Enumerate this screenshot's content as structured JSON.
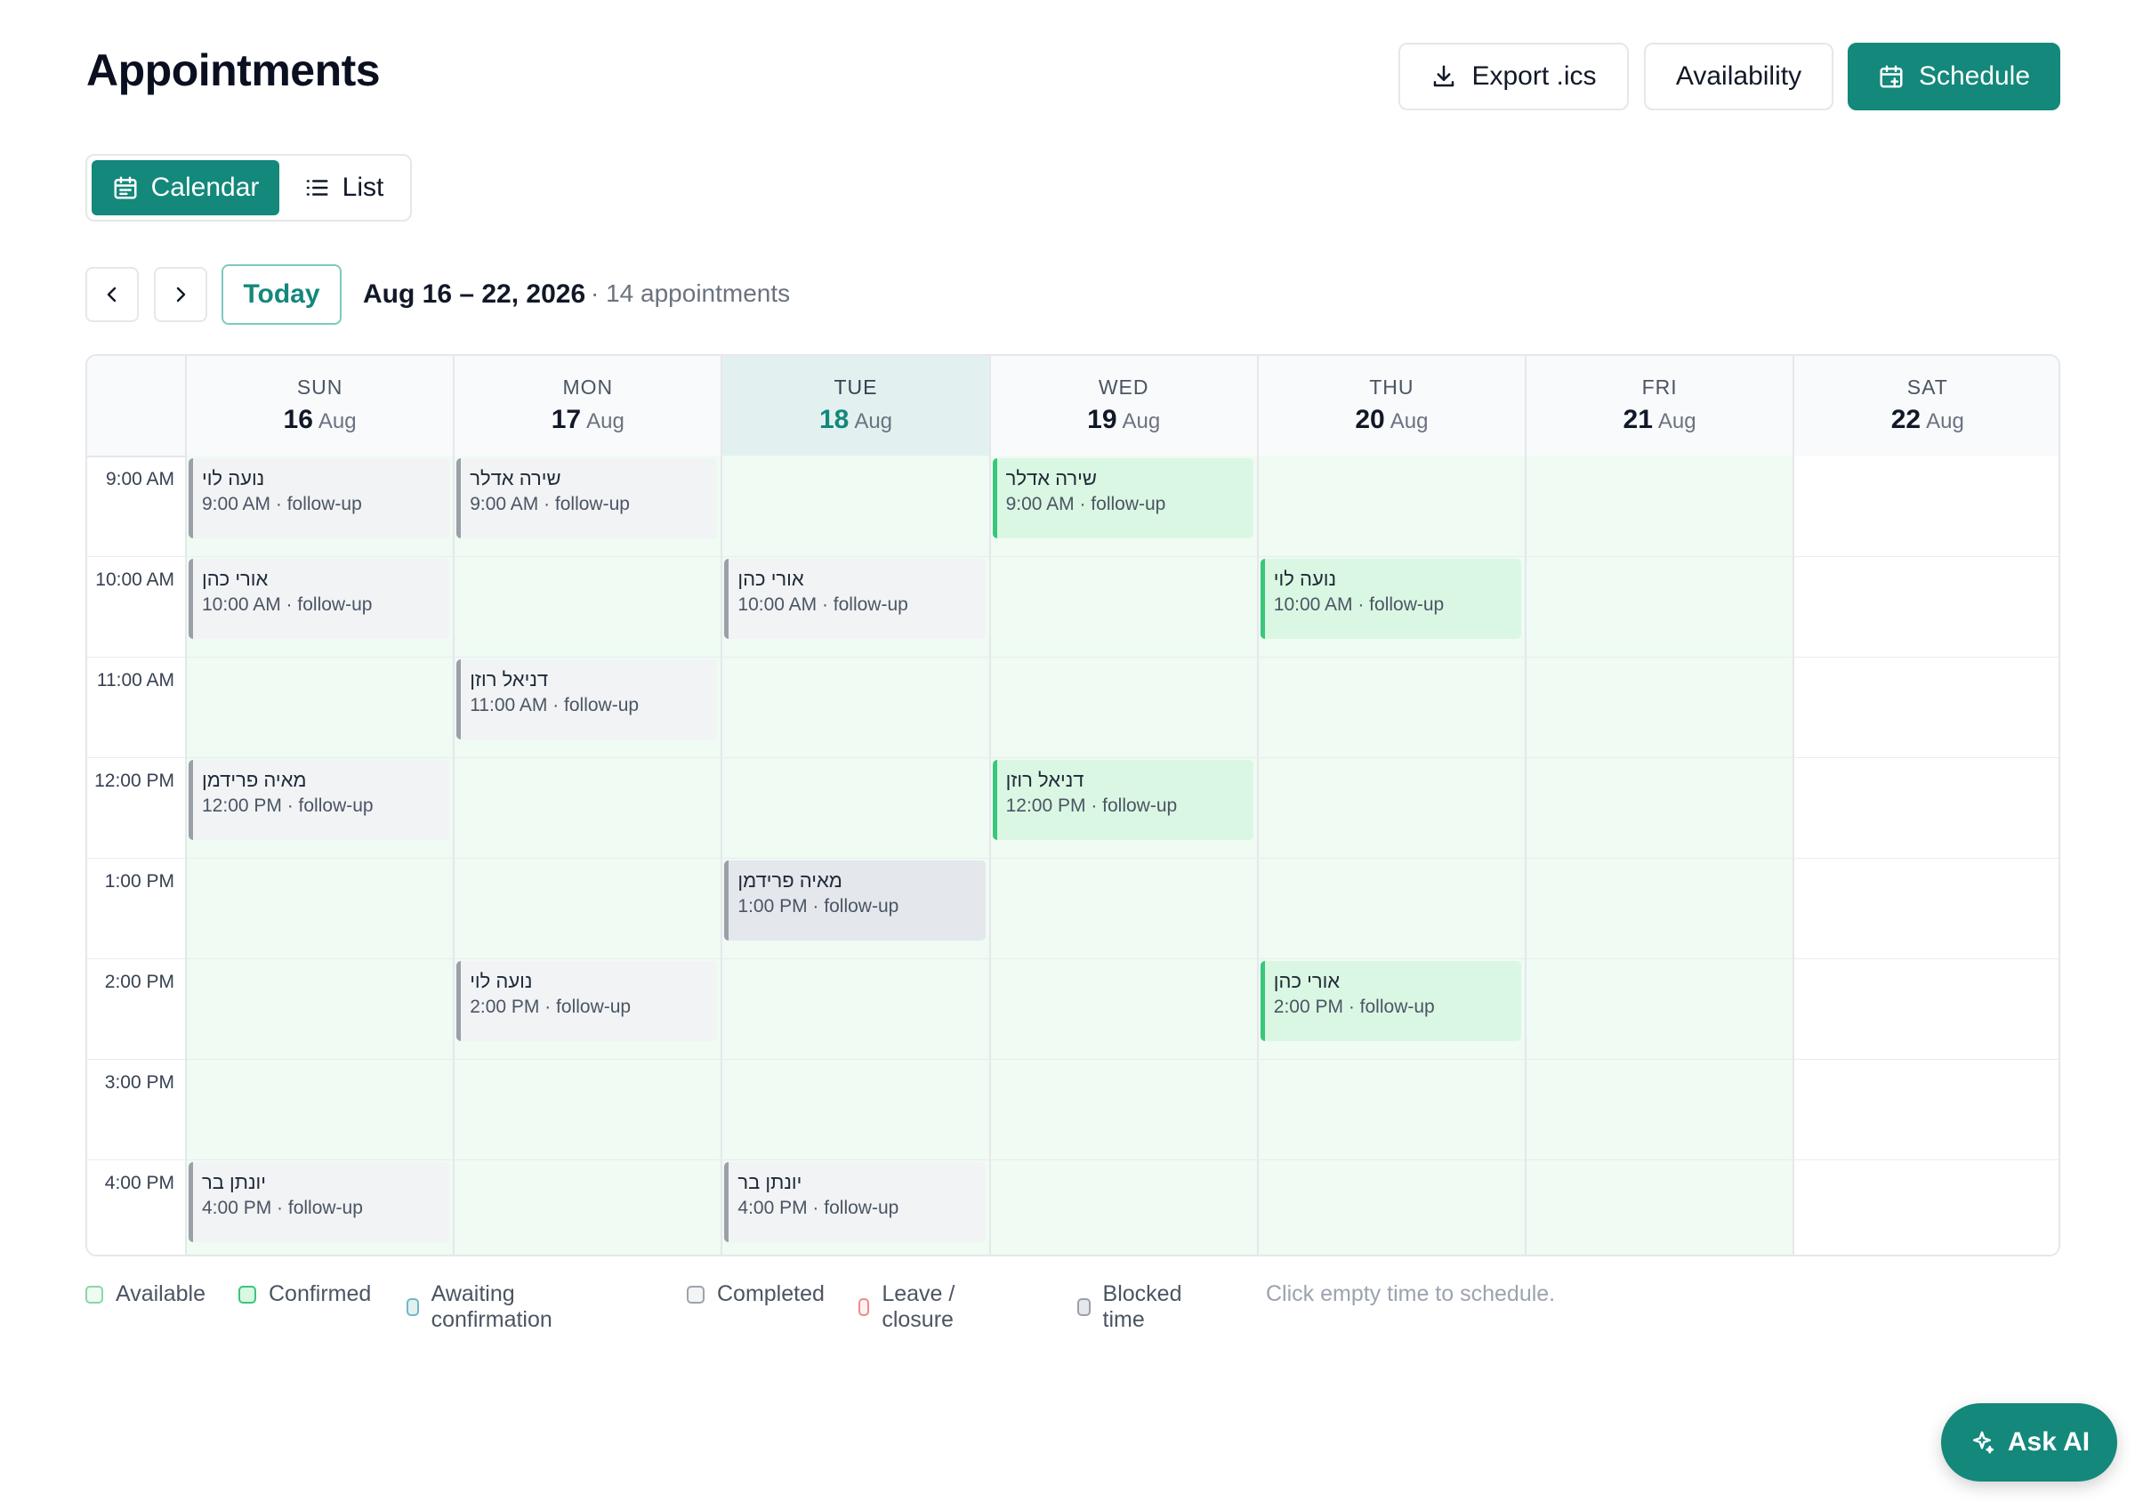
{
  "header": {
    "title": "Appointments",
    "export_label": "Export .ics",
    "availability_label": "Availability",
    "schedule_label": "Schedule"
  },
  "view_toggle": {
    "calendar_label": "Calendar",
    "list_label": "List",
    "active": "Calendar"
  },
  "nav": {
    "today_label": "Today",
    "range": "Aug 16 – 22, 2026",
    "count": "· 14 appointments"
  },
  "calendar": {
    "days": [
      {
        "name": "SUN",
        "date": "16",
        "month": "Aug"
      },
      {
        "name": "MON",
        "date": "17",
        "month": "Aug"
      },
      {
        "name": "TUE",
        "date": "18",
        "month": "Aug"
      },
      {
        "name": "WED",
        "date": "19",
        "month": "Aug"
      },
      {
        "name": "THU",
        "date": "20",
        "month": "Aug"
      },
      {
        "name": "FRI",
        "date": "21",
        "month": "Aug"
      },
      {
        "name": "SAT",
        "date": "22",
        "month": "Aug"
      }
    ],
    "today_index": 2,
    "times": [
      "9:00 AM",
      "10:00 AM",
      "11:00 AM",
      "12:00 PM",
      "1:00 PM",
      "2:00 PM",
      "3:00 PM",
      "4:00 PM"
    ],
    "available_days": [
      0,
      1,
      2,
      3,
      4,
      5
    ],
    "appointments": [
      {
        "day": 0,
        "slot": 0,
        "name": "נועה לוי",
        "detail": "9:00 AM · follow-up",
        "status": "completed"
      },
      {
        "day": 0,
        "slot": 1,
        "name": "אורי כהן",
        "detail": "10:00 AM · follow-up",
        "status": "completed"
      },
      {
        "day": 0,
        "slot": 3,
        "name": "מאיה פרידמן",
        "detail": "12:00 PM · follow-up",
        "status": "completed"
      },
      {
        "day": 0,
        "slot": 7,
        "name": "יונתן בר",
        "detail": "4:00 PM · follow-up",
        "status": "completed"
      },
      {
        "day": 1,
        "slot": 0,
        "name": "שירה אדלר",
        "detail": "9:00 AM · follow-up",
        "status": "completed"
      },
      {
        "day": 1,
        "slot": 2,
        "name": "דניאל רוזן",
        "detail": "11:00 AM · follow-up",
        "status": "completed"
      },
      {
        "day": 1,
        "slot": 5,
        "name": "נועה לוי",
        "detail": "2:00 PM · follow-up",
        "status": "completed"
      },
      {
        "day": 2,
        "slot": 1,
        "name": "אורי כהן",
        "detail": "10:00 AM · follow-up",
        "status": "completed"
      },
      {
        "day": 2,
        "slot": 4,
        "name": "מאיה פרידמן",
        "detail": "1:00 PM · follow-up",
        "status": "blocked"
      },
      {
        "day": 2,
        "slot": 7,
        "name": "יונתן בר",
        "detail": "4:00 PM · follow-up",
        "status": "completed"
      },
      {
        "day": 3,
        "slot": 0,
        "name": "שירה אדלר",
        "detail": "9:00 AM · follow-up",
        "status": "confirmed"
      },
      {
        "day": 3,
        "slot": 3,
        "name": "דניאל רוזן",
        "detail": "12:00 PM · follow-up",
        "status": "confirmed"
      },
      {
        "day": 4,
        "slot": 1,
        "name": "נועה לוי",
        "detail": "10:00 AM · follow-up",
        "status": "confirmed"
      },
      {
        "day": 4,
        "slot": 5,
        "name": "אורי כהן",
        "detail": "2:00 PM · follow-up",
        "status": "confirmed"
      }
    ]
  },
  "legend": [
    {
      "label": "Available",
      "border": "#86d9a6",
      "fill": "#effbf3"
    },
    {
      "label": "Confirmed",
      "border": "#3ac67b",
      "fill": "#daf7e3"
    },
    {
      "label": "Awaiting confirmation",
      "border": "#6fb8c9",
      "fill": "#e2f1f0"
    },
    {
      "label": "Completed",
      "border": "#9ca3af",
      "fill": "#f3f4f6"
    },
    {
      "label": "Leave / closure",
      "border": "#f08a8a",
      "fill": "#fff1f1"
    },
    {
      "label": "Blocked time",
      "border": "#9aa0a8",
      "fill": "#e4e7ec"
    }
  ],
  "hint": "Click empty time to schedule.",
  "ask_ai_label": "Ask AI",
  "colors": {
    "brand": "#13887b",
    "available_bg": "#effbf3",
    "today_header": "#e2f1f0"
  }
}
